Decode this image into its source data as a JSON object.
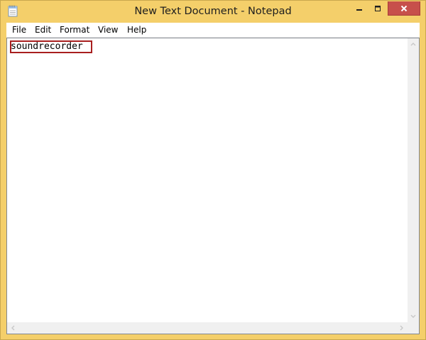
{
  "window": {
    "title": "New Text Document - Notepad",
    "frame_color": "#f4cf6a",
    "close_button_color": "#c7504b"
  },
  "titlebar_icons": {
    "app": "notepad-icon",
    "minimize": "minimize-icon",
    "maximize": "maximize-icon",
    "close": "close-icon"
  },
  "menu": {
    "file": "File",
    "edit": "Edit",
    "format": "Format",
    "view": "View",
    "help": "Help"
  },
  "editor": {
    "content": "soundrecorder",
    "highlight_color": "#a81f1f"
  },
  "scrollbar_icons": {
    "up": "chevron-up-icon",
    "down": "chevron-down-icon",
    "left": "chevron-left-icon",
    "right": "chevron-right-icon"
  }
}
